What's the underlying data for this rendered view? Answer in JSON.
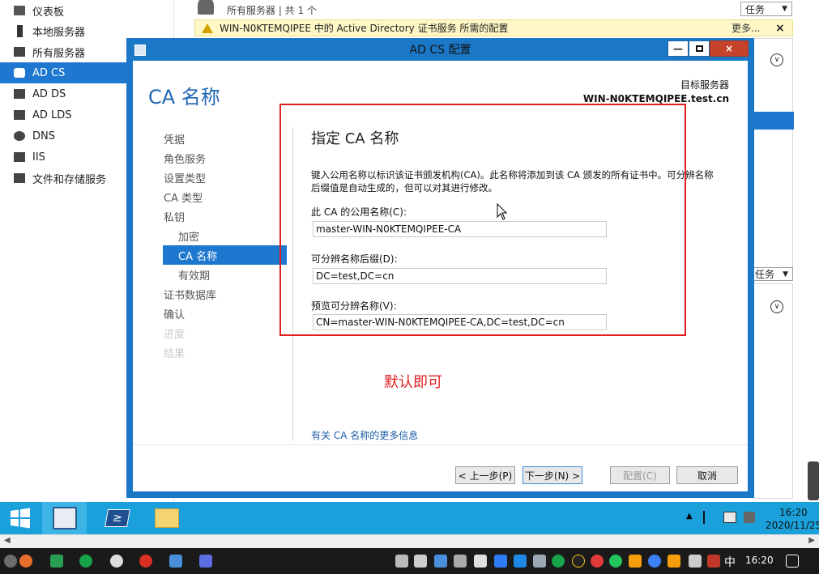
{
  "server_manager": {
    "sidebar": [
      {
        "label": "仪表板",
        "icon": "dashboard-icon"
      },
      {
        "label": "本地服务器",
        "icon": "local-server-icon"
      },
      {
        "label": "所有服务器",
        "icon": "all-servers-icon"
      },
      {
        "label": "AD CS",
        "icon": "adcs-icon",
        "active": true
      },
      {
        "label": "AD DS",
        "icon": "adds-icon"
      },
      {
        "label": "AD LDS",
        "icon": "adlds-icon"
      },
      {
        "label": "DNS",
        "icon": "dns-icon"
      },
      {
        "label": "IIS",
        "icon": "iis-icon"
      },
      {
        "label": "文件和存储服务",
        "icon": "file-storage-icon"
      }
    ],
    "header_subtitle": "所有服务器 | 共 1 个",
    "tasks_label": "任务",
    "tasks_label_2": "任务",
    "notice": {
      "text": "WIN-N0KTEMQIPEE 中的 Active Directory 证书服务 所需的配置",
      "more": "更多...",
      "close": "×"
    }
  },
  "dialog": {
    "title": "AD CS 配置",
    "page_title": "CA 名称",
    "target_label": "目标服务器",
    "target_server": "WIN-N0KTEMQIPEE.test.cn",
    "nav": [
      {
        "label": "凭据",
        "state": "normal"
      },
      {
        "label": "角色服务",
        "state": "normal"
      },
      {
        "label": "设置类型",
        "state": "normal"
      },
      {
        "label": "CA 类型",
        "state": "normal"
      },
      {
        "label": "私钥",
        "state": "normal"
      },
      {
        "label": "加密",
        "state": "sub"
      },
      {
        "label": "CA 名称",
        "state": "active"
      },
      {
        "label": "有效期",
        "state": "sub"
      },
      {
        "label": "证书数据库",
        "state": "normal"
      },
      {
        "label": "确认",
        "state": "normal"
      },
      {
        "label": "进度",
        "state": "disabled"
      },
      {
        "label": "结果",
        "state": "disabled"
      }
    ],
    "section_heading": "指定 CA 名称",
    "description_line1": "键入公用名称以标识该证书颁发机构(CA)。此名称将添加到该 CA 颁发的所有证书中。可分辨名称",
    "description_line2": "后缀值是自动生成的，但可以对其进行修改。",
    "common_name_label": "此 CA 的公用名称(C):",
    "common_name_value": "master-WIN-N0KTEMQIPEE-CA",
    "dn_suffix_label": "可分辨名称后缀(D):",
    "dn_suffix_value": "DC=test,DC=cn",
    "preview_label": "预览可分辨名称(V):",
    "preview_value": "CN=master-WIN-N0KTEMQIPEE-CA,DC=test,DC=cn",
    "annotation_note": "默认即可",
    "more_info_link": "有关 CA 名称的更多信息",
    "buttons": {
      "back": "< 上一步(P)",
      "next": "下一步(N) >",
      "configure": "配置(C)",
      "cancel": "取消"
    }
  },
  "taskbar": {
    "time": "16:20",
    "date": "2020/11/25"
  },
  "host_taskbar": {
    "ime": "中",
    "time": "16:20"
  },
  "colors": {
    "accent": "#1e78d0",
    "dialog_frame": "#1b78c7",
    "annotation_red": "#e02020",
    "taskbar": "#1aa0da"
  }
}
